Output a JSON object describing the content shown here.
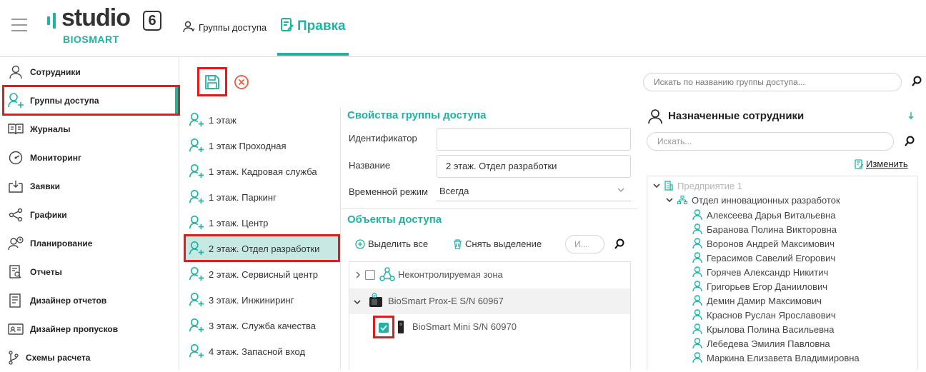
{
  "header": {
    "logo_text": "studio",
    "logo_version": "6",
    "logo_brand": "BIOSMART",
    "breadcrumb_label": "Группы доступа",
    "active_tab_label": "Правка"
  },
  "sidebar": {
    "items": [
      {
        "label": "Сотрудники",
        "icon": "user-icon"
      },
      {
        "label": "Группы доступа",
        "icon": "user-group-add-icon"
      },
      {
        "label": "Журналы",
        "icon": "book-icon"
      },
      {
        "label": "Мониторинг",
        "icon": "gauge-icon"
      },
      {
        "label": "Заявки",
        "icon": "inbox-icon"
      },
      {
        "label": "Графики",
        "icon": "share-icon"
      },
      {
        "label": "Планирование",
        "icon": "user-clock-icon"
      },
      {
        "label": "Отчеты",
        "icon": "report-icon"
      },
      {
        "label": "Дизайнер отчетов",
        "icon": "report-designer-icon"
      },
      {
        "label": "Дизайнер пропусков",
        "icon": "id-card-icon"
      },
      {
        "label": "Схемы расчета",
        "icon": "branch-icon"
      }
    ]
  },
  "toolbar": {
    "search_placeholder": "Искать по названию группы доступа..."
  },
  "groups": {
    "items": [
      "1 этаж",
      "1 этаж Проходная",
      "1 этаж. Кадровая служба",
      "1 этаж. Паркинг",
      "1 этаж. Центр",
      "2 этаж. Отдел разработки",
      "2 этаж. Сервисный центр",
      "3 этаж. Инжиниринг",
      "3 этаж. Служба качества",
      "4 этаж. Запасной вход"
    ]
  },
  "properties": {
    "title": "Свойства группы доступа",
    "id_label": "Идентификатор",
    "id_value": "",
    "name_label": "Название",
    "name_value": "2 этаж. Отдел разработки",
    "time_label": "Временной режим",
    "time_value": "Всегда"
  },
  "access_objects": {
    "title": "Объекты доступа",
    "select_all": "Выделить все",
    "deselect": "Снять выделение",
    "search_placeholder": "И...",
    "rows": [
      {
        "label": "Неконтролируемая зона",
        "checked": false
      },
      {
        "label": "BioSmart Prox-E S/N 60967"
      },
      {
        "label": "BioSmart Mini S/N 60970",
        "checked": true
      }
    ]
  },
  "employees": {
    "title": "Назначенные сотрудники",
    "search_placeholder": "Искать...",
    "change_label": "Изменить",
    "org": "Предприятие 1",
    "dept": "Отдел инновационных разработок",
    "people": [
      "Алексеева Дарья Витальевна",
      "Баранова Полина Викторовна",
      "Воронов Андрей Максимович",
      "Герасимов Савелий Егорович",
      "Горячев Александр Никитич",
      "Григорьев Егор Даниилович",
      "Демин Дамир Максимович",
      "Краснов Руслан Ярославович",
      "Крылова Полина Васильевна",
      "Лебедева Эмилия Павловна",
      "Маркина Елизавета Владимировна"
    ]
  },
  "colors": {
    "accent": "#1fb3a3",
    "highlight": "#e01c1c",
    "selected_bg": "#c6e9e4"
  }
}
